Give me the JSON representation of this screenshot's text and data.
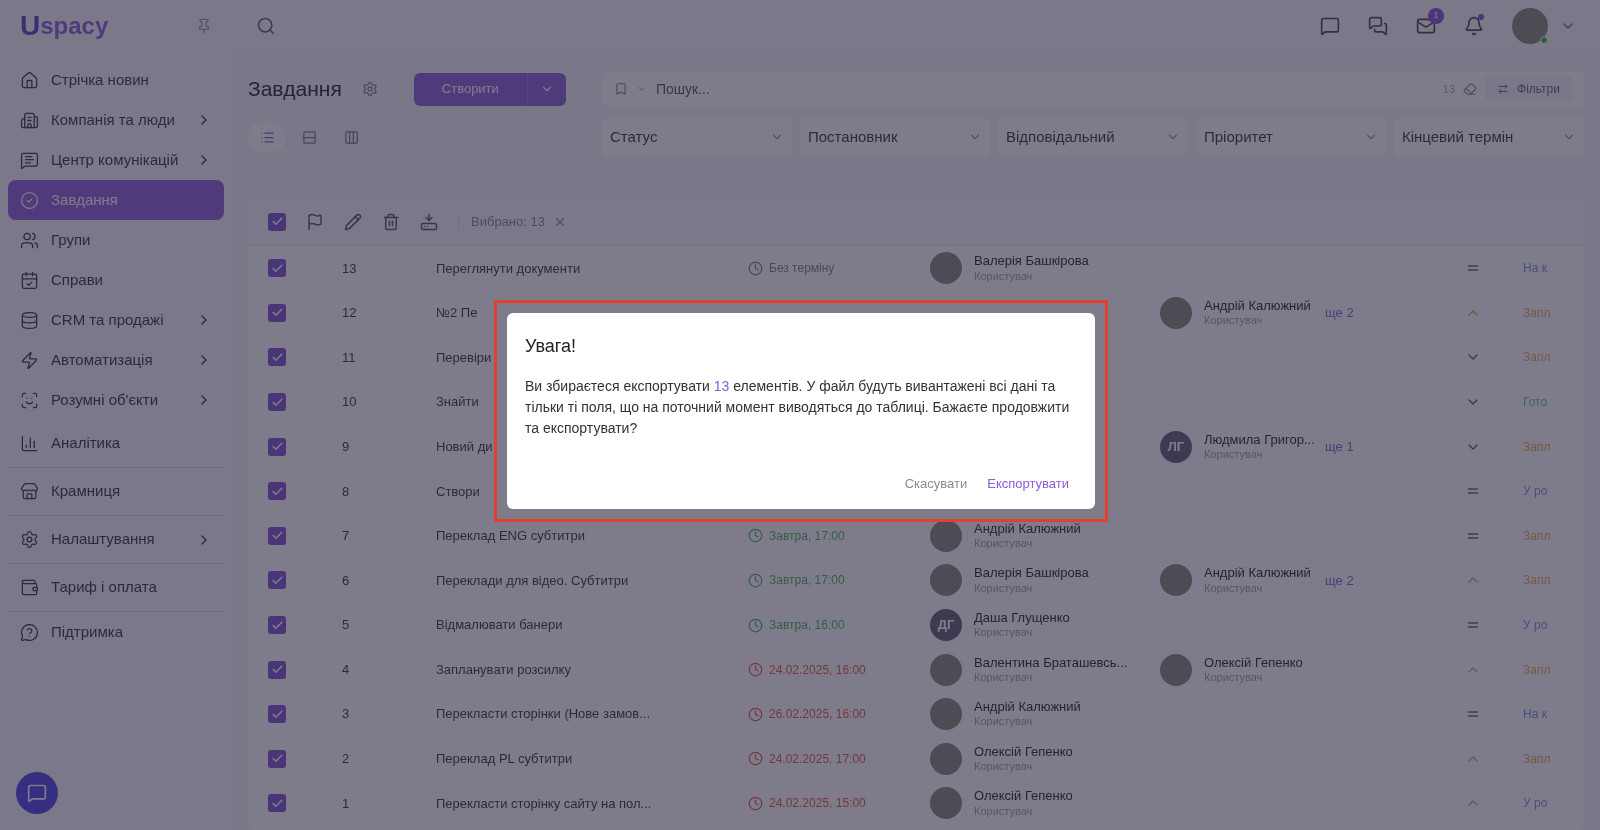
{
  "logo": {
    "mark": "U",
    "text": "spacy"
  },
  "sidebar": {
    "items": [
      {
        "label": "Стрічка новин",
        "has_submenu": false,
        "selected": false,
        "divider_after": false
      },
      {
        "label": "Компанія та люди",
        "has_submenu": true,
        "selected": false,
        "divider_after": false
      },
      {
        "label": "Центр комунікацій",
        "has_submenu": true,
        "selected": false,
        "divider_after": false
      },
      {
        "label": "Завдання",
        "has_submenu": false,
        "selected": true,
        "divider_after": false
      },
      {
        "label": "Групи",
        "has_submenu": false,
        "selected": false,
        "divider_after": false
      },
      {
        "label": "Справи",
        "has_submenu": false,
        "selected": false,
        "divider_after": false
      },
      {
        "label": "CRM та продажі",
        "has_submenu": true,
        "selected": false,
        "divider_after": false
      },
      {
        "label": "Автоматизація",
        "has_submenu": true,
        "selected": false,
        "divider_after": false
      },
      {
        "label": "Розумні об'єкти",
        "has_submenu": true,
        "selected": false,
        "divider_after": false
      },
      {
        "label": "Аналітика",
        "has_submenu": false,
        "selected": false,
        "divider_after": true
      },
      {
        "label": "Крамниця",
        "has_submenu": false,
        "selected": false,
        "divider_after": true
      },
      {
        "label": "Налаштування",
        "has_submenu": true,
        "selected": false,
        "divider_after": true
      },
      {
        "label": "Тариф і оплата",
        "has_submenu": false,
        "selected": false,
        "divider_after": true
      },
      {
        "label": "Підтримка",
        "has_submenu": false,
        "selected": false,
        "divider_after": false
      }
    ]
  },
  "header": {
    "mail_badge": "1",
    "bell_dot": true,
    "user_online": true
  },
  "page": {
    "title": "Завдання",
    "create_button": "Створити",
    "search": {
      "placeholder": "Пошук...",
      "count": "13"
    },
    "filters_button": "Фільтри",
    "views": [
      {
        "kind": "list",
        "selected": true
      },
      {
        "kind": "rows",
        "selected": false
      },
      {
        "kind": "columns",
        "selected": false
      }
    ],
    "filters": [
      "Статус",
      "Постановник",
      "Відповідальний",
      "Пріоритет",
      "Кінцевий термін"
    ]
  },
  "table": {
    "all_checked": true,
    "selected_label": "Вибрано: 13",
    "rows": [
      {
        "checked": true,
        "number": "13",
        "title": "Переглянути документи",
        "due": {
          "kind": "none",
          "text": "Без терміну"
        },
        "assignee": {
          "name": "Валерія Башкірова",
          "role": "Користувач"
        },
        "responsible": null,
        "priority": {
          "kind": "equal"
        },
        "status": {
          "text": "На к",
          "kind": "review"
        }
      },
      {
        "checked": true,
        "number": "12",
        "title": "№2 Пе",
        "due": null,
        "assignee": null,
        "responsible": {
          "name": "Андрій Калюжний",
          "role": "Користувач",
          "more": "ще 2"
        },
        "priority": {
          "kind": "up"
        },
        "status": {
          "text": "Запл",
          "kind": "planned"
        }
      },
      {
        "checked": true,
        "number": "11",
        "title": "Перевіри",
        "due": null,
        "assignee": null,
        "responsible": null,
        "priority": {
          "kind": "down"
        },
        "status": {
          "text": "Запл",
          "kind": "planned"
        }
      },
      {
        "checked": true,
        "number": "10",
        "title": "Знайти",
        "due": null,
        "assignee": null,
        "responsible": null,
        "priority": {
          "kind": "down"
        },
        "status": {
          "text": "Гото",
          "kind": "done"
        }
      },
      {
        "checked": true,
        "number": "9",
        "title": "Новий ди",
        "due": null,
        "assignee": null,
        "responsible": {
          "name": "Людмила Григор...",
          "role": "Користувач",
          "more": "ще 1",
          "initials": "ЛГ"
        },
        "priority": {
          "kind": "down"
        },
        "status": {
          "text": "Запл",
          "kind": "planned"
        }
      },
      {
        "checked": true,
        "number": "8",
        "title": "Створи",
        "due": null,
        "assignee": null,
        "responsible": null,
        "priority": {
          "kind": "equal"
        },
        "status": {
          "text": "У ро",
          "kind": "in_progress"
        }
      },
      {
        "checked": true,
        "number": "7",
        "title": "Переклад ENG субтитри",
        "due": {
          "kind": "soon",
          "text": "Завтра, 17:00"
        },
        "assignee": {
          "name": "Андрій Калюжний",
          "role": "Користувач"
        },
        "responsible": null,
        "priority": {
          "kind": "equal"
        },
        "status": {
          "text": "Запл",
          "kind": "planned"
        }
      },
      {
        "checked": true,
        "number": "6",
        "title": "Переклади для відео. Субтитри",
        "due": {
          "kind": "soon",
          "text": "Завтра, 17:00"
        },
        "assignee": {
          "name": "Валерія Башкірова",
          "role": "Користувач"
        },
        "responsible": {
          "name": "Андрій Калюжний",
          "role": "Користувач",
          "more": "ще 2"
        },
        "priority": {
          "kind": "up"
        },
        "status": {
          "text": "Запл",
          "kind": "planned"
        }
      },
      {
        "checked": true,
        "number": "5",
        "title": "Відмалювати банери",
        "due": {
          "kind": "soon",
          "text": "Завтра, 16:00"
        },
        "assignee": {
          "name": "Даша Глущенко",
          "role": "Користувач",
          "initials": "ДГ"
        },
        "responsible": null,
        "priority": {
          "kind": "equal"
        },
        "status": {
          "text": "У ро",
          "kind": "in_progress"
        }
      },
      {
        "checked": true,
        "number": "4",
        "title": "Запланувати розсилку",
        "due": {
          "kind": "overdue",
          "text": "24.02.2025, 16:00"
        },
        "assignee": {
          "name": "Валентина Браташевсь...",
          "role": "Користувач"
        },
        "responsible": {
          "name": "Олексій Гепенко",
          "role": "Користувач"
        },
        "priority": {
          "kind": "up"
        },
        "status": {
          "text": "Запл",
          "kind": "planned"
        }
      },
      {
        "checked": true,
        "number": "3",
        "title": "Перекласти сторінки (Нове замов...",
        "due": {
          "kind": "overdue",
          "text": "26.02.2025, 16:00"
        },
        "assignee": {
          "name": "Андрій Калюжний",
          "role": "Користувач"
        },
        "responsible": null,
        "priority": {
          "kind": "equal"
        },
        "status": {
          "text": "На к",
          "kind": "review"
        }
      },
      {
        "checked": true,
        "number": "2",
        "title": "Переклад PL субтитри",
        "due": {
          "kind": "overdue",
          "text": "24.02.2025, 17:00"
        },
        "assignee": {
          "name": "Олексій Гепенко",
          "role": "Користувач"
        },
        "responsible": null,
        "priority": {
          "kind": "up"
        },
        "status": {
          "text": "Запл",
          "kind": "planned"
        }
      },
      {
        "checked": true,
        "number": "1",
        "title": "Перекласти сторінку сайту на пол...",
        "due": {
          "kind": "overdue",
          "text": "24.02.2025, 15:00"
        },
        "assignee": {
          "name": "Олексій Гепенко",
          "role": "Користувач"
        },
        "responsible": null,
        "priority": {
          "kind": "up"
        },
        "status": {
          "text": "У ро",
          "kind": "in_progress"
        }
      }
    ]
  },
  "dialog": {
    "title": "Увага!",
    "message": [
      {
        "text": "Ви збираєтеся експортувати ",
        "accent": false
      },
      {
        "text": "13",
        "accent": true
      },
      {
        "text": " елементів. У файл будуть вивантажені всі дані та тільки ті поля, що на поточний момент виводяться до таблиці. Бажаєте продовжити та експортувати?",
        "accent": false
      }
    ],
    "cancel": "Скасувати",
    "confirm": "Експортувати",
    "highlighted_frame": true
  }
}
